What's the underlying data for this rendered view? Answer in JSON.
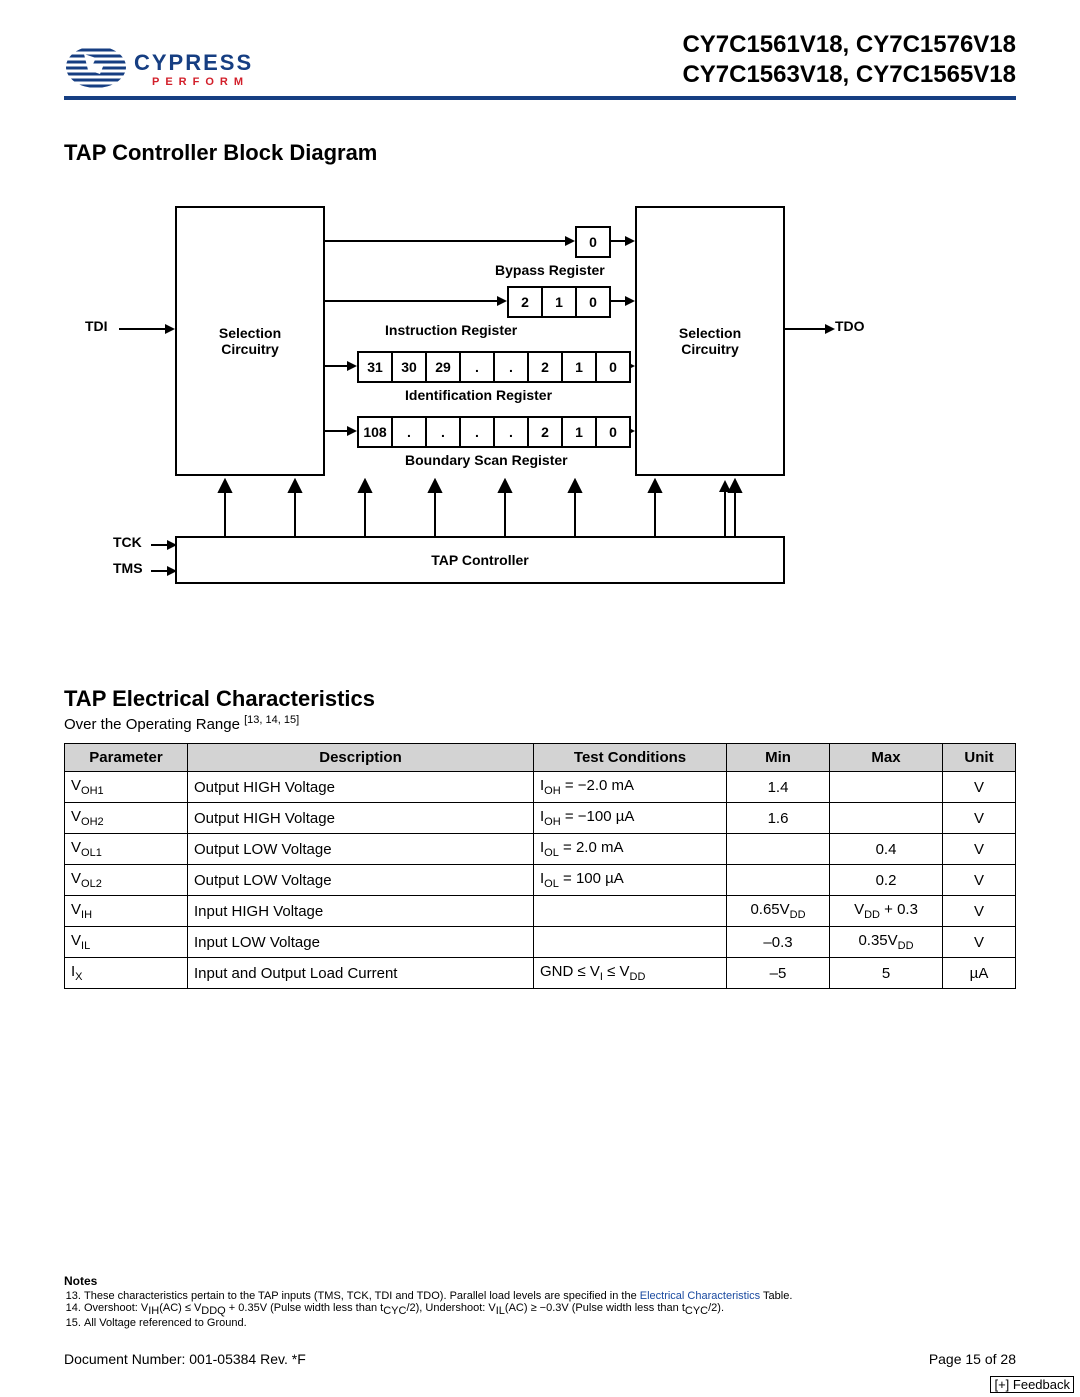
{
  "header": {
    "brand": "CYPRESS",
    "tagline": "PERFORM",
    "parts_line1": "CY7C1561V18, CY7C1576V18",
    "parts_line2": "CY7C1563V18, CY7C1565V18"
  },
  "section1_title": "TAP Controller Block Diagram",
  "diagram": {
    "tdi": "TDI",
    "tdo": "TDO",
    "tck": "TCK",
    "tms": "TMS",
    "sel_circ": "Selection Circuitry",
    "bypass_reg": "Bypass Register",
    "instruction_reg": "Instruction Register",
    "identification_reg": "Identification Register",
    "boundary_reg": "Boundary Scan Register",
    "tap_controller": "TAP Controller",
    "bypass_cells": [
      "0"
    ],
    "instr_cells": [
      "2",
      "1",
      "0"
    ],
    "id_cells": [
      "31",
      "30",
      "29",
      ".",
      ".",
      "2",
      "1",
      "0"
    ],
    "bsr_cells": [
      "108",
      ".",
      ".",
      ".",
      ".",
      "2",
      "1",
      "0"
    ]
  },
  "section2_title": "TAP Electrical Characteristics",
  "section2_sub_prefix": "Over the Operating Range ",
  "section2_refs": "[13, 14, 15]",
  "table": {
    "headers": [
      "Parameter",
      "Description",
      "Test Conditions",
      "Min",
      "Max",
      "Unit"
    ],
    "rows": [
      {
        "param_base": "V",
        "param_sub": "OH1",
        "desc": "Output HIGH Voltage",
        "cond_pre": "I",
        "cond_sub": "OH",
        "cond_post": " = −2.0 mA",
        "min": "1.4",
        "max": "",
        "unit": "V"
      },
      {
        "param_base": "V",
        "param_sub": "OH2",
        "desc": "Output HIGH Voltage",
        "cond_pre": "I",
        "cond_sub": "OH",
        "cond_post": " = −100 µA",
        "min": "1.6",
        "max": "",
        "unit": "V"
      },
      {
        "param_base": "V",
        "param_sub": "OL1",
        "desc": "Output LOW Voltage",
        "cond_pre": "I",
        "cond_sub": "OL",
        "cond_post": " = 2.0 mA",
        "min": "",
        "max": "0.4",
        "unit": "V"
      },
      {
        "param_base": "V",
        "param_sub": "OL2",
        "desc": "Output LOW Voltage",
        "cond_pre": "I",
        "cond_sub": "OL",
        "cond_post": " = 100 µA",
        "min": "",
        "max": "0.2",
        "unit": "V"
      },
      {
        "param_base": "V",
        "param_sub": "IH",
        "desc": "Input HIGH Voltage",
        "cond_pre": "",
        "cond_sub": "",
        "cond_post": "",
        "min": "0.65V_DD",
        "max": "V_DD + 0.3",
        "unit": "V"
      },
      {
        "param_base": "V",
        "param_sub": "IL",
        "desc": "Input LOW Voltage",
        "cond_pre": "",
        "cond_sub": "",
        "cond_post": "",
        "min": "–0.3",
        "max": "0.35V_DD",
        "unit": "V"
      },
      {
        "param_base": "I",
        "param_sub": "X",
        "desc": "Input and Output Load Current",
        "cond_pre": "GND ≤ V",
        "cond_sub": "I",
        "cond_post": " ≤ V_DD",
        "min": "–5",
        "max": "5",
        "unit": "µA"
      }
    ]
  },
  "notes": {
    "title": "Notes",
    "items": [
      {
        "n": "13",
        "text_pre": "These characteristics pertain to the TAP inputs (TMS, TCK, TDI and TDO). Parallel load levels are specified in the ",
        "link": "Electrical Characteristics",
        "text_post": " Table."
      },
      {
        "n": "14",
        "text_pre": "Overshoot: V",
        "sub1": "IH",
        "mid1": "(AC) ≤ V",
        "sub2": "DDQ",
        "mid2": " + 0.35V (Pulse width less than t",
        "sub3": "CYC",
        "mid3": "/2), Undershoot: V",
        "sub4": "IL",
        "mid4": "(AC) ≥ −0.3V (Pulse width less than t",
        "sub5": "CYC",
        "text_post": "/2)."
      },
      {
        "n": "15",
        "text_pre": "All Voltage referenced to Ground.",
        "text_post": ""
      }
    ]
  },
  "footer": {
    "doc": "Document Number: 001-05384 Rev. *F",
    "page": "Page 15 of 28",
    "feedback": "[+] Feedback"
  }
}
